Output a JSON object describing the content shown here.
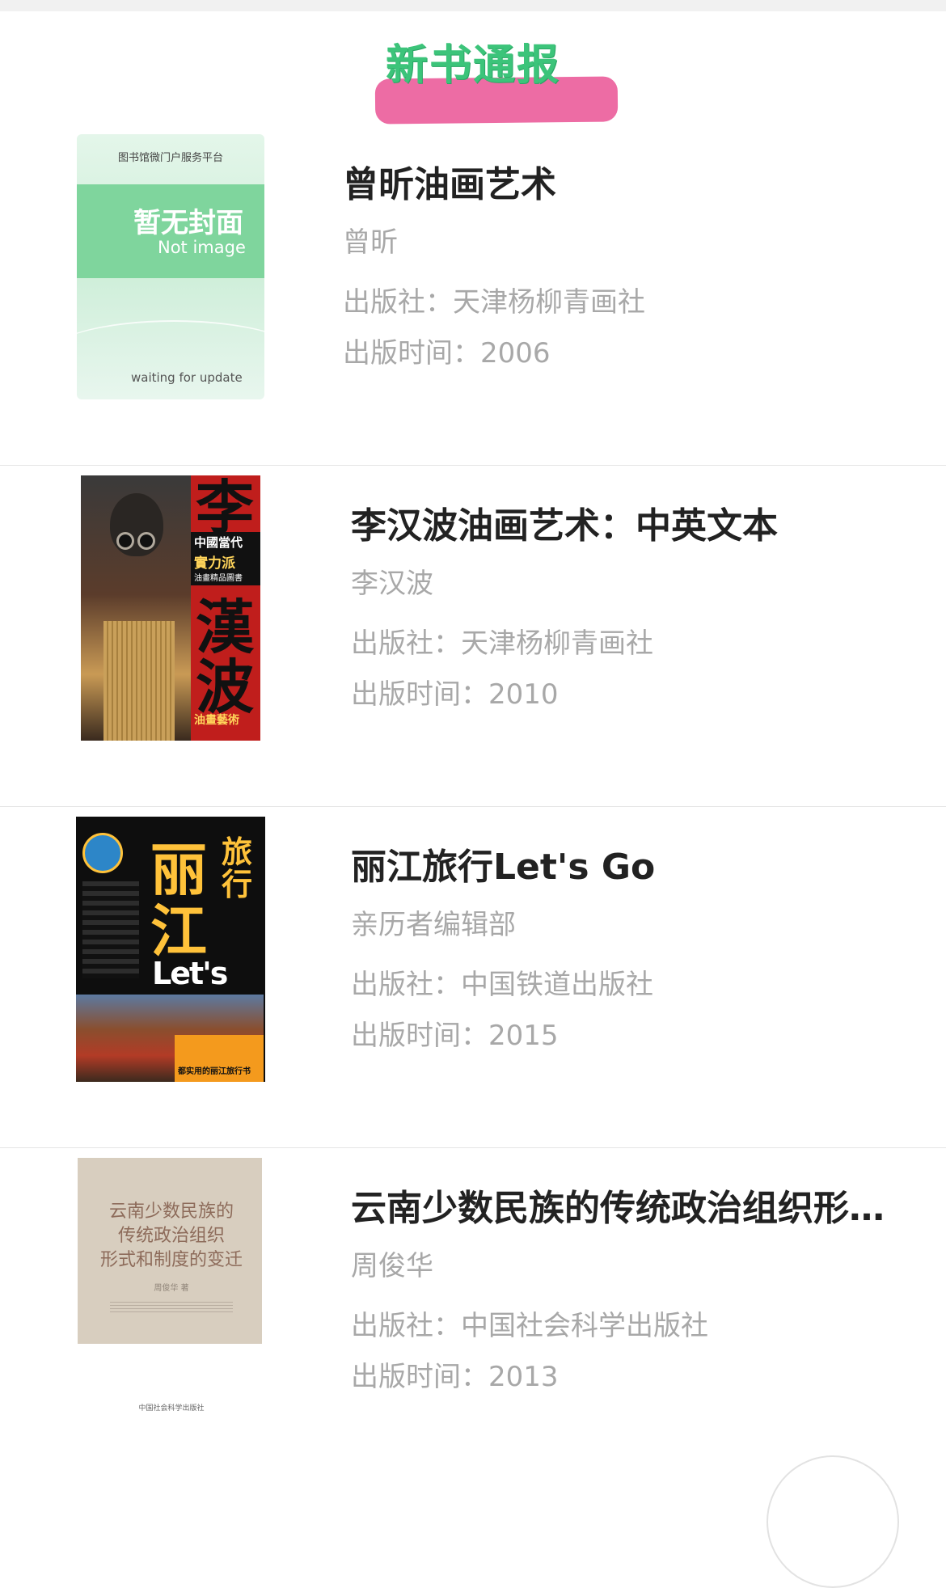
{
  "header": {
    "title": "新书通报"
  },
  "labels": {
    "publisher_prefix": "出版社：",
    "date_prefix": "出版时间："
  },
  "books": [
    {
      "title": "曾昕油画艺术",
      "author": "曾昕",
      "publisher": "天津杨柳青画社",
      "year": "2006",
      "cover": {
        "top": "图书馆微门户服务平台",
        "zh": "暂无封面",
        "en": "Not image",
        "bottom": "waiting for update"
      }
    },
    {
      "title": "李汉波油画艺术：中英文本",
      "author": "李汉波",
      "publisher": "天津杨柳青画社",
      "year": "2010",
      "cover": {
        "li": "李",
        "han": "漢",
        "bo": "波",
        "band1": "中國當代",
        "band2": "實力派",
        "band3": "油畫精品圖書",
        "foot": "油畫藝術"
      }
    },
    {
      "title": "丽江旅行Let's Go",
      "author": "亲历者编辑部",
      "publisher": "中国铁道出版社",
      "year": "2015",
      "cover": {
        "li": "丽",
        "jiang": "江",
        "lvxing": "旅行",
        "letsgo": "Let's Go",
        "foot": "都实用的丽江旅行书"
      }
    },
    {
      "title": "云南少数民族的传统政治组织形式和制度的变迁",
      "author": "周俊华",
      "publisher": "中国社会科学出版社",
      "year": "2013",
      "cover": {
        "l1": "云南少数民族的",
        "l2": "传统政治组织",
        "l3": "形式和制度的变迁",
        "author": "周俊华 著"
      }
    }
  ]
}
